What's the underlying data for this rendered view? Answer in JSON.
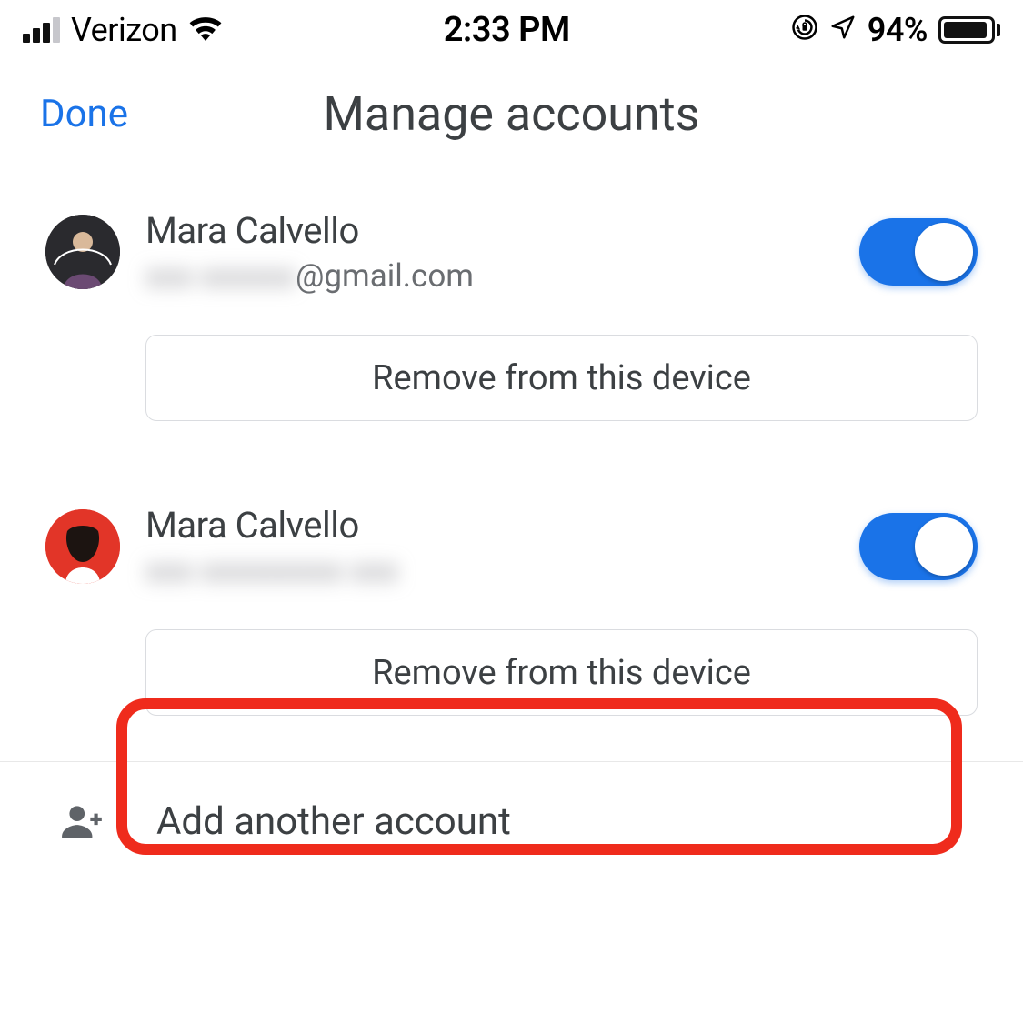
{
  "status_bar": {
    "carrier": "Verizon",
    "time": "2:33 PM",
    "battery_percent": "94%"
  },
  "header": {
    "done_label": "Done",
    "title": "Manage accounts"
  },
  "accounts": [
    {
      "name": "Mara Calvello",
      "email_obscured": "xxx xxxxxx",
      "email_visible": "@gmail.com",
      "toggle_on": true,
      "remove_label": "Remove from this device",
      "highlighted": false
    },
    {
      "name": "Mara Calvello",
      "email_obscured": "xxx xxxxxxxxx xxx",
      "email_visible": "",
      "toggle_on": true,
      "remove_label": "Remove from this device",
      "highlighted": true
    }
  ],
  "footer": {
    "add_label": "Add another account"
  },
  "colors": {
    "link": "#1a73e8",
    "toggle_on": "#1a73e8",
    "highlight_border": "#ef2b1c"
  }
}
